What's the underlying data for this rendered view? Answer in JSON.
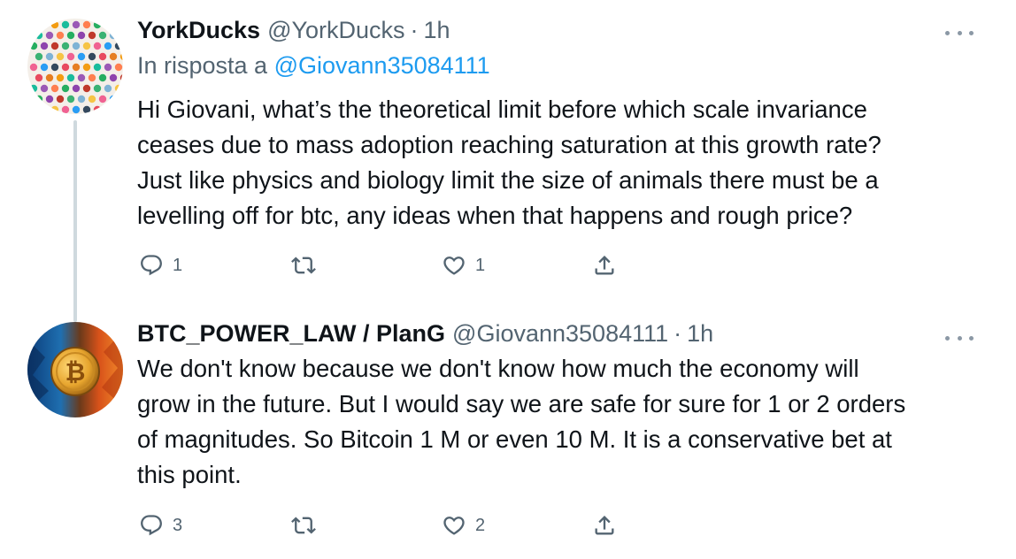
{
  "tweets": [
    {
      "display_name": "YorkDucks",
      "handle": "@YorkDucks",
      "separator": "·",
      "time": "1h",
      "reply_prefix": "In risposta a",
      "reply_mention": "@Giovann35084111",
      "text": "Hi Giovani, what’s the theoretical limit before which scale invariance\nceases due to mass adoption reaching saturation at this growth rate?\nJust like physics and biology limit the size of animals there must be a\nlevelling off for btc, any ideas when that happens and rough price?",
      "avatar_icon": "dot-pattern-avatar",
      "actions": {
        "reply_count": "1",
        "retweet_count": "",
        "like_count": "1"
      }
    },
    {
      "display_name": "BTC_POWER_LAW / PlanG",
      "handle": "@Giovann35084111",
      "separator": "·",
      "time": "1h",
      "text": "We don't know because we don't know how much the economy will\ngrow in the future. But I would say we are safe for sure for 1 or 2 orders\nof magnitudes. So Bitcoin 1 M or even 10 M. It is a conservative bet at\nthis point.",
      "avatar_icon": "bitcoin-fire-ice-avatar",
      "actions": {
        "reply_count": "3",
        "retweet_count": "",
        "like_count": "2"
      }
    }
  ],
  "colors": {
    "text": "#0f1419",
    "secondary": "#536471",
    "link": "#1d9bf0",
    "thread_line": "#cfd9de"
  }
}
